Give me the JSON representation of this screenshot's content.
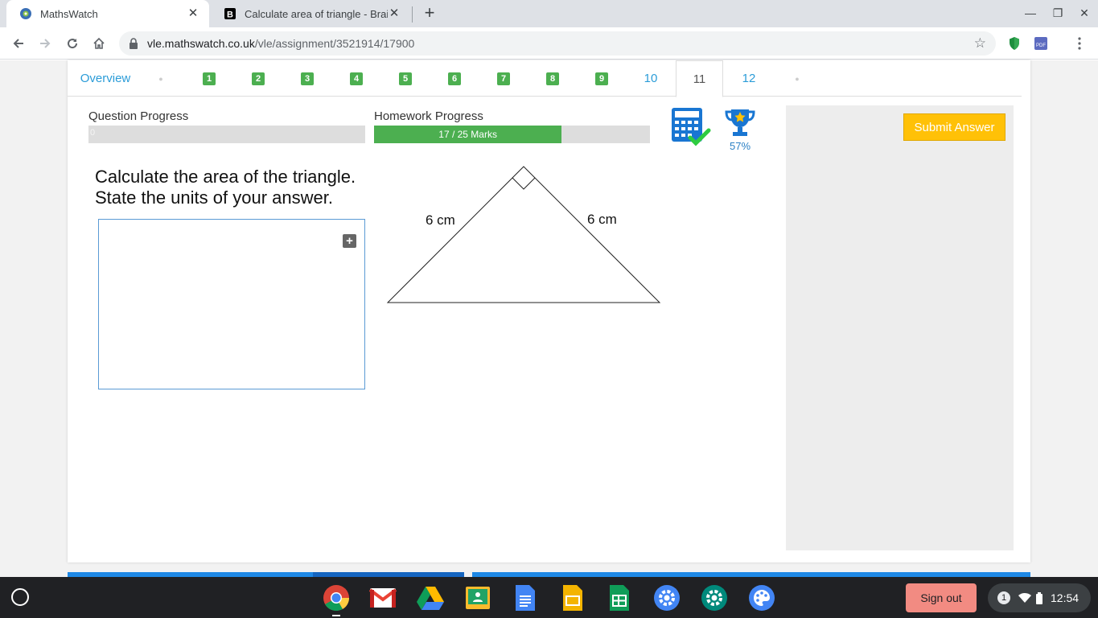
{
  "browser": {
    "tabs": [
      {
        "title": "MathsWatch",
        "active": true
      },
      {
        "title": "Calculate area of triangle - Brainl",
        "active": false
      }
    ],
    "url": {
      "host": "vle.mathswatch.co.uk",
      "path": "/vle/assignment/3521914/17900"
    }
  },
  "nav": {
    "overview_label": "Overview",
    "questions": [
      {
        "label": "1",
        "done": true
      },
      {
        "label": "2",
        "done": true
      },
      {
        "label": "3",
        "done": true
      },
      {
        "label": "4",
        "done": true
      },
      {
        "label": "5",
        "done": true
      },
      {
        "label": "6",
        "done": true
      },
      {
        "label": "7",
        "done": true
      },
      {
        "label": "8",
        "done": true
      },
      {
        "label": "9",
        "done": true
      },
      {
        "label": "10",
        "done": false
      },
      {
        "label": "11",
        "done": false,
        "active": true
      },
      {
        "label": "12",
        "done": false
      }
    ]
  },
  "progress": {
    "question_label": "Question Progress",
    "question_value_text": "0",
    "question_fraction": 0,
    "homework_label": "Homework Progress",
    "homework_text": "17 / 25 Marks",
    "homework_fraction": 0.68
  },
  "trophy_percent": "57%",
  "submit_label": "Submit Answer",
  "question": {
    "line1": "Calculate the area of the triangle.",
    "line2": "State the units of your answer."
  },
  "diagram": {
    "left_side_label": "6 cm",
    "right_side_label": "6 cm"
  },
  "shelf": {
    "signout_label": "Sign out",
    "notification_count": "1",
    "time": "12:54"
  },
  "colors": {
    "accent_blue": "#2b9cd8",
    "done_green": "#4caf50",
    "submit_yellow": "#ffc107"
  }
}
